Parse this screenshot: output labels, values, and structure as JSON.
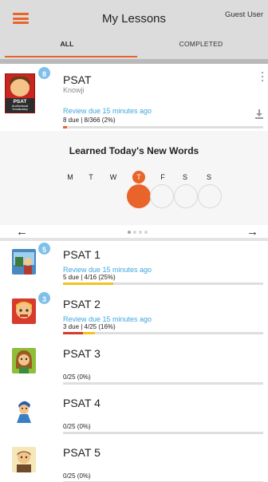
{
  "header": {
    "title": "My Lessons",
    "user": "Guest User",
    "tabs": {
      "all": "ALL",
      "completed": "COMPLETED"
    },
    "accent_color": "#e8642a"
  },
  "featured": {
    "badge": "8",
    "cover_title": "PSAT",
    "cover_subtitle": "Audiovisual Vocabulary",
    "title": "PSAT",
    "publisher": "Knowji",
    "review": "Review due 15 minutes ago",
    "due": "8 due | 8/366 (2%)",
    "progress_pct": 2
  },
  "streak": {
    "title": "Learned Today's New Words",
    "days": [
      "M",
      "T",
      "W",
      "T",
      "F",
      "S",
      "S"
    ],
    "today_index": 3,
    "completed_index": 3,
    "page_index": 0,
    "page_count": 4
  },
  "lessons": [
    {
      "title": "PSAT 1",
      "badge": "5",
      "review": "Review due 15 minutes ago",
      "due": "5 due | 4/16 (25%)",
      "progress": [
        {
          "pct": 25,
          "color": "#f2c320"
        }
      ]
    },
    {
      "title": "PSAT 2",
      "badge": "3",
      "review": "Review due 15 minutes ago",
      "due": "3 due | 4/25 (16%)",
      "progress": [
        {
          "pct": 10,
          "color": "#d83a2e"
        },
        {
          "pct": 6,
          "color": "#f2c320"
        }
      ]
    },
    {
      "title": "PSAT 3",
      "badge": "",
      "review": "",
      "due": "0/25 (0%)",
      "progress": []
    },
    {
      "title": "PSAT 4",
      "badge": "",
      "review": "",
      "due": "0/25 (0%)",
      "progress": []
    },
    {
      "title": "PSAT 5",
      "badge": "",
      "review": "",
      "due": "0/25 (0%)",
      "progress": []
    }
  ]
}
